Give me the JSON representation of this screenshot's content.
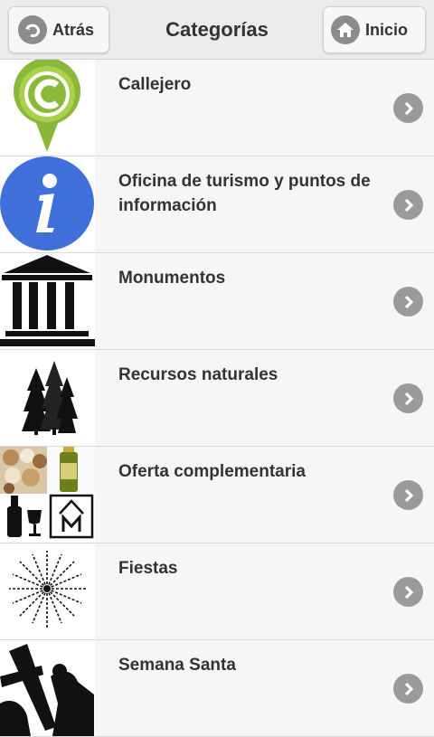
{
  "header": {
    "back_label": "Atrás",
    "title": "Categorías",
    "home_label": "Inicio"
  },
  "categories": [
    {
      "label": "Callejero",
      "icon": "map-pin-c-icon"
    },
    {
      "label": "Oficina de turismo y puntos de información",
      "icon": "info-icon"
    },
    {
      "label": "Monumentos",
      "icon": "monument-icon"
    },
    {
      "label": "Recursos naturales",
      "icon": "trees-icon"
    },
    {
      "label": "Oferta complementaria",
      "icon": "complementary-offer-icon"
    },
    {
      "label": "Fiestas",
      "icon": "fireworks-icon"
    },
    {
      "label": "Semana Santa",
      "icon": "holy-week-icon"
    }
  ]
}
